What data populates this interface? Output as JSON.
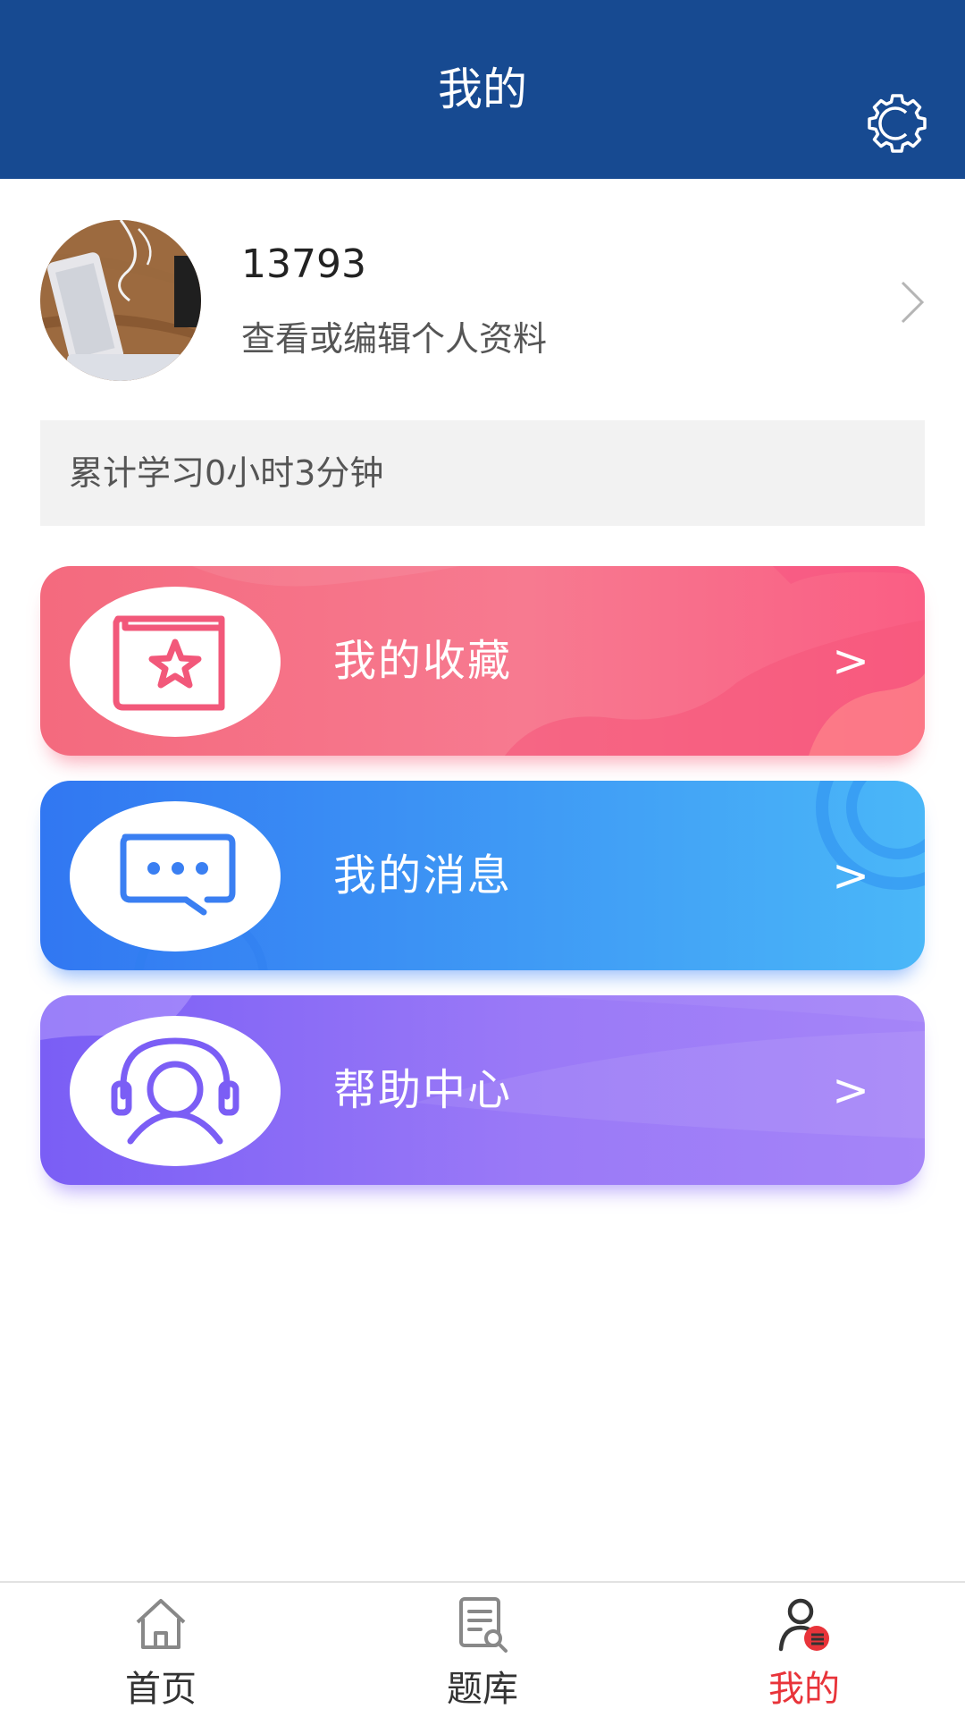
{
  "header": {
    "title": "我的",
    "settings_icon": "gear-icon"
  },
  "profile": {
    "username": "13793",
    "subtitle": "查看或编辑个人资料",
    "chevron_icon": "chevron-right-icon"
  },
  "study": {
    "text": "累计学习0小时3分钟"
  },
  "menu": [
    {
      "label": "我的收藏",
      "arrow": ">",
      "icon": "favorites-book-star-icon",
      "color": "#f46a7e"
    },
    {
      "label": "我的消息",
      "arrow": ">",
      "icon": "message-chat-icon",
      "color": "#3f8cf4"
    },
    {
      "label": "帮助中心",
      "arrow": ">",
      "icon": "headset-support-icon",
      "color": "#8c6cf6"
    }
  ],
  "bottom_nav": {
    "items": [
      {
        "label": "首页",
        "icon": "home-icon",
        "active": false
      },
      {
        "label": "题库",
        "icon": "question-bank-icon",
        "active": false
      },
      {
        "label": "我的",
        "icon": "profile-icon",
        "active": true
      }
    ],
    "active_color": "#e8343a"
  },
  "colors": {
    "header_bg": "#174a91",
    "study_bg": "#f2f2f2"
  }
}
